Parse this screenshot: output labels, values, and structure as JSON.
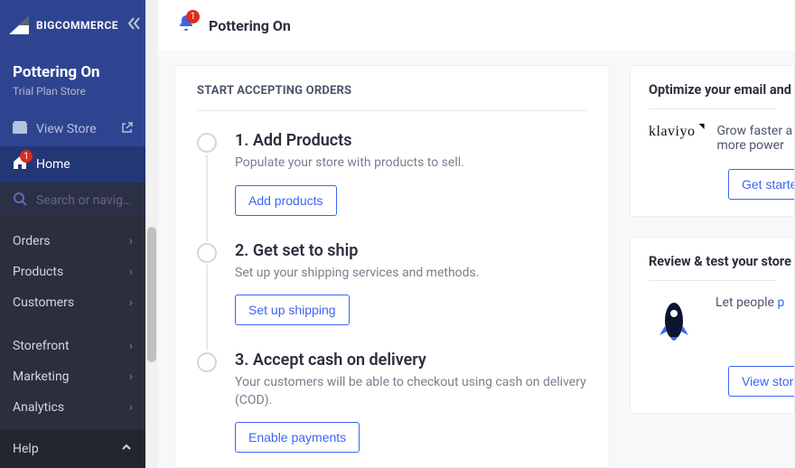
{
  "brand": {
    "name": "BIGCOMMERCE"
  },
  "store": {
    "name": "Pottering On",
    "plan": "Trial Plan Store",
    "view_label": "View Store"
  },
  "sidebar": {
    "home": {
      "label": "Home",
      "badge": "1"
    },
    "search_placeholder": "Search or navig…",
    "groups1": [
      {
        "label": "Orders"
      },
      {
        "label": "Products"
      },
      {
        "label": "Customers"
      }
    ],
    "groups2": [
      {
        "label": "Storefront"
      },
      {
        "label": "Marketing"
      },
      {
        "label": "Analytics"
      }
    ],
    "help_label": "Help"
  },
  "topbar": {
    "title": "Pottering On",
    "bell_badge": "1"
  },
  "onboarding": {
    "section_title": "START ACCEPTING ORDERS",
    "steps": [
      {
        "title": "1. Add Products",
        "desc": "Populate your store with products to sell.",
        "button": "Add products"
      },
      {
        "title": "2. Get set to ship",
        "desc": "Set up your shipping services and methods.",
        "button": "Set up shipping"
      },
      {
        "title": "3. Accept cash on delivery",
        "desc": "Your customers will be able to checkout using cash on delivery (COD).",
        "button": "Enable payments"
      }
    ]
  },
  "promos": {
    "klaviyo": {
      "title": "Optimize your email and SM",
      "logo_alt": "klaviyo",
      "pitch": "Grow faster a",
      "pitch2": "more power",
      "cta": "Get started"
    },
    "review": {
      "title": "Review & test your store",
      "pitch": "Let people ",
      "pitch_link": "p",
      "cta": "View store"
    }
  }
}
